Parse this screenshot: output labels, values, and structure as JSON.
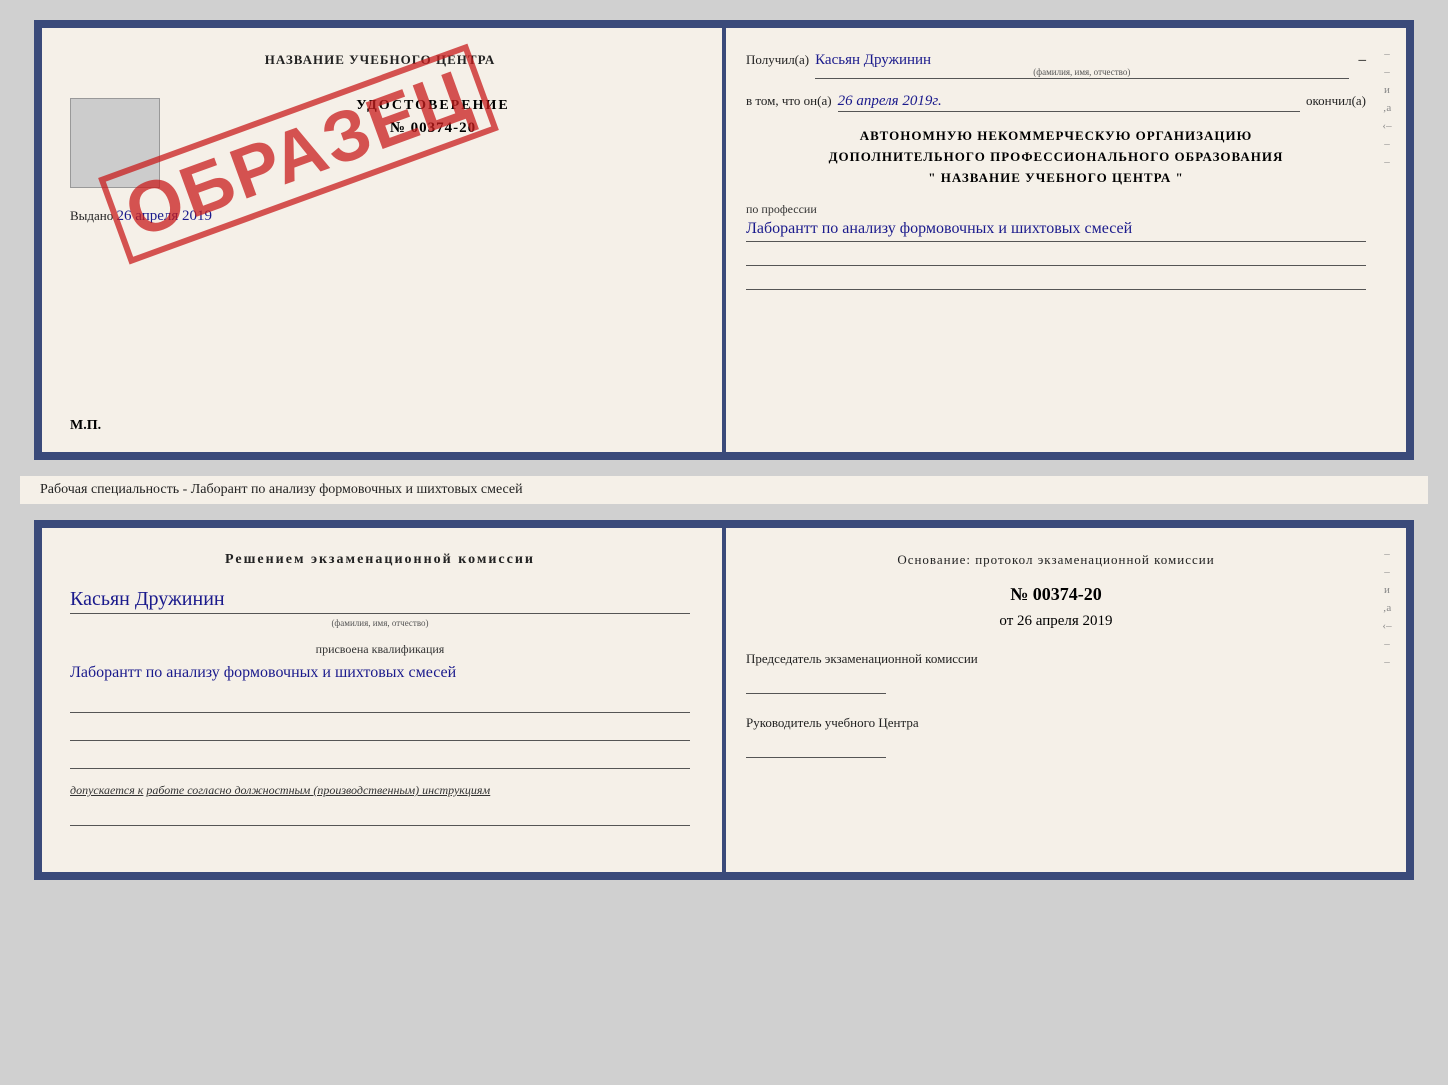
{
  "top_document": {
    "left": {
      "title": "НАЗВАНИЕ УЧЕБНОГО ЦЕНТРА",
      "stamp": "ОБРАЗЕЦ",
      "cert_label": "УДОСТОВЕРЕНИЕ",
      "cert_number": "№ 00374-20",
      "issued_label": "Выдано",
      "issued_date": "26 апреля 2019",
      "mp_label": "М.П."
    },
    "right": {
      "received_label": "Получил(а)",
      "received_name": "Касьян Дружинин",
      "name_sublabel": "(фамилия, имя, отчество)",
      "date_label": "в том, что он(а)",
      "date_value": "26 апреля 2019г.",
      "finished_label": "окончил(а)",
      "org_line1": "АВТОНОМНУЮ НЕКОММЕРЧЕСКУЮ ОРГАНИЗАЦИЮ",
      "org_line2": "ДОПОЛНИТЕЛЬНОГО ПРОФЕССИОНАЛЬНОГО ОБРАЗОВАНИЯ",
      "org_line3": "\"   НАЗВАНИЕ УЧЕБНОГО ЦЕНТРА   \"",
      "profession_label": "по профессии",
      "profession_value": "Лаборантт по анализу формовочных и шихтовых смесей"
    }
  },
  "middle_label": "Рабочая специальность - Лаборант по анализу формовочных и шихтовых смесей",
  "bottom_document": {
    "left": {
      "title": "Решением экзаменационной комиссии",
      "name": "Касьян Дружинин",
      "name_sublabel": "(фамилия, имя, отчество)",
      "qual_label": "присвоена квалификация",
      "qual_value": "Лаборантт по анализу формовочных и шихтовых смесей",
      "допуск_label": "допускается к",
      "допуск_value": "работе согласно должностным (производственным) инструкциям"
    },
    "right": {
      "osnov_label": "Основание: протокол экзаменационной комиссии",
      "protocol_number": "№ 00374-20",
      "date_prefix": "от",
      "date_value": "26 апреля 2019",
      "chairman_label": "Председатель экзаменационной комиссии",
      "director_label": "Руководитель учебного Центра"
    }
  }
}
